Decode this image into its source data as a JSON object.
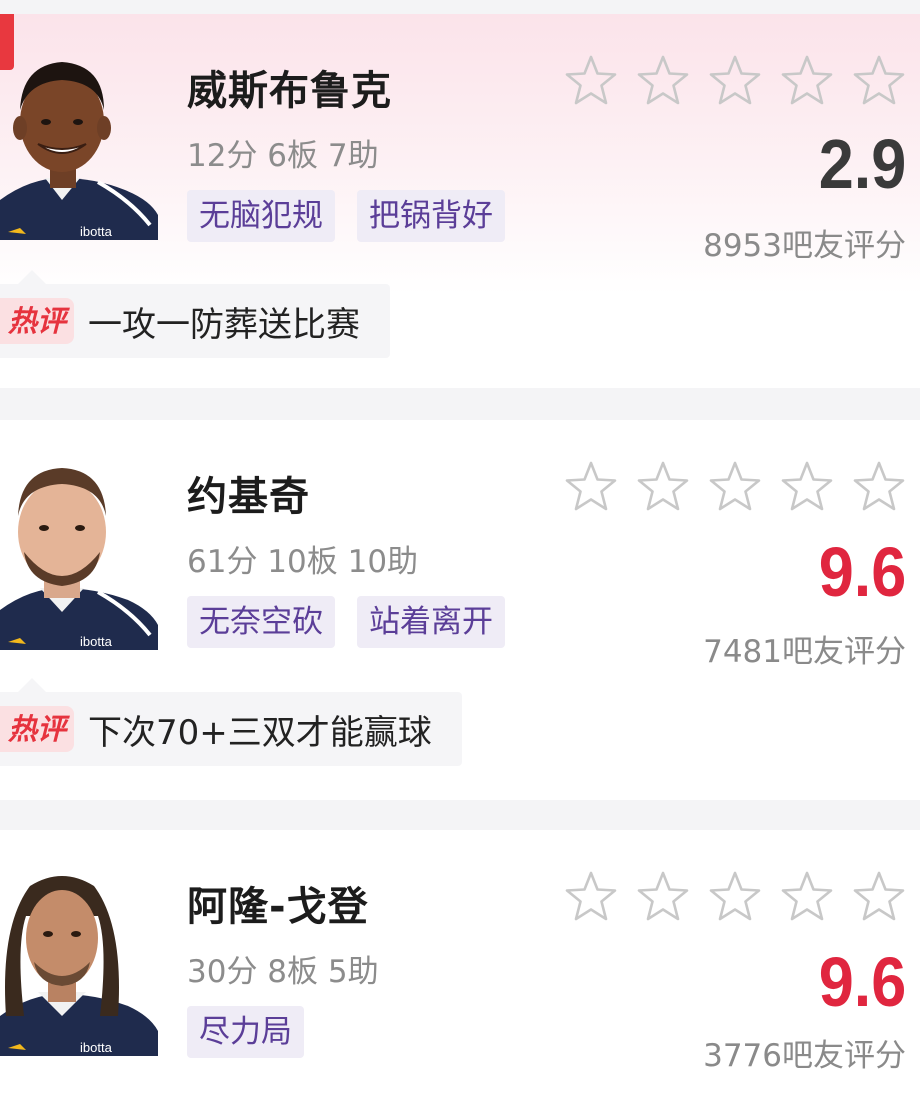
{
  "players": [
    {
      "name": "威斯布鲁克",
      "stats": "12分 6板 7助",
      "tags": [
        "无脑犯规",
        "把锅背好"
      ],
      "score": "2.9",
      "score_color": "#3a3a3a",
      "rating_count": "8953吧友评分",
      "hot_label": "热评",
      "hot_comment": "一攻一防葬送比赛",
      "avatar_icon": "westbrook-avatar",
      "stars_filled": 0,
      "stars_total": 5,
      "jersey_text": "ibotta"
    },
    {
      "name": "约基奇",
      "stats": "61分 10板 10助",
      "tags": [
        "无奈空砍",
        "站着离开"
      ],
      "score": "9.6",
      "score_color": "#e0263f",
      "rating_count": "7481吧友评分",
      "hot_label": "热评",
      "hot_comment": "下次70+三双才能赢球",
      "avatar_icon": "jokic-avatar",
      "stars_filled": 0,
      "stars_total": 5,
      "jersey_text": "ibotta"
    },
    {
      "name": "阿隆-戈登",
      "stats": "30分 8板 5助",
      "tags": [
        "尽力局"
      ],
      "score": "9.6",
      "score_color": "#e0263f",
      "rating_count": "3776吧友评分",
      "avatar_icon": "gordon-avatar",
      "stars_filled": 0,
      "stars_total": 5,
      "jersey_text": "ibotta"
    }
  ],
  "colors": {
    "accent_red": "#e0263f",
    "tag_bg": "#efecf6",
    "tag_text": "#5b3e98",
    "star_outline": "#c8c8c8"
  }
}
